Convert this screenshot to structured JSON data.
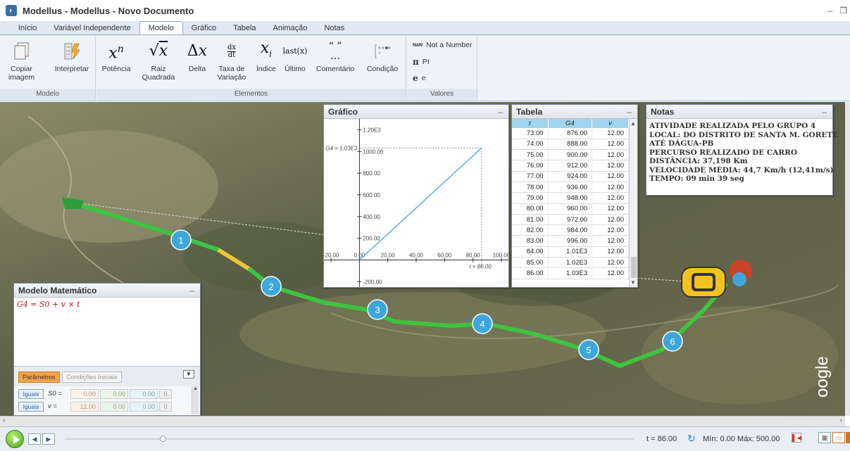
{
  "window": {
    "title": "Modellus - Modellus - Novo Documento"
  },
  "tabs": [
    {
      "label": "Início"
    },
    {
      "label": "Variável Independente"
    },
    {
      "label": "Modelo"
    },
    {
      "label": "Gráfico"
    },
    {
      "label": "Tabela"
    },
    {
      "label": "Animação"
    },
    {
      "label": "Notas"
    }
  ],
  "ribbon": {
    "modelo_group": {
      "label": "Modelo",
      "copy": "Copiar imagem",
      "interpret": "Interpretar"
    },
    "elementos_group": {
      "label": "Elementos",
      "potencia": "Potência",
      "raiz_1": "Raiz",
      "raiz_2": "Quadrada",
      "delta": "Delta",
      "taxa_1": "Taxa de",
      "taxa_2": "Variação",
      "indice": "Índice",
      "ultimo": "Último",
      "comentario": "Comentário",
      "condicao": "Condição",
      "last_symbol": "last(x)"
    },
    "valores_group": {
      "label": "Valores",
      "nan_tag": "NaN",
      "nan": "Not a Number",
      "pi_symbol": "π",
      "pi": "PI",
      "e_symbol": "e",
      "e": "e"
    }
  },
  "grafico": {
    "title": "Gráfico",
    "marker_left": "G4 = 1.03E3",
    "marker_bottom": "t = 86.00",
    "chart_data": {
      "type": "line",
      "x": [
        0,
        86
      ],
      "y": [
        0,
        1032
      ],
      "xlim": [
        -25,
        105
      ],
      "ylim": [
        -250,
        1300
      ],
      "xticks": [
        "-20.00",
        "0.00",
        "20.00",
        "40.00",
        "60.00",
        "80.00",
        "100.00"
      ],
      "yticks": [
        "-200.00",
        "200.00",
        "400.00",
        "600.00",
        "800.00",
        "1000.00",
        "1.20E3"
      ]
    }
  },
  "tabela": {
    "title": "Tabela",
    "columns": [
      "t",
      "G4",
      "v"
    ],
    "rows": [
      [
        "73.00",
        "876.00",
        "12.00"
      ],
      [
        "74.00",
        "888.00",
        "12.00"
      ],
      [
        "75.00",
        "900.00",
        "12.00"
      ],
      [
        "76.00",
        "912.00",
        "12.00"
      ],
      [
        "77.00",
        "924.00",
        "12.00"
      ],
      [
        "78.00",
        "936.00",
        "12.00"
      ],
      [
        "79.00",
        "948.00",
        "12.00"
      ],
      [
        "80.00",
        "960.00",
        "12.00"
      ],
      [
        "81.00",
        "972.00",
        "12.00"
      ],
      [
        "82.00",
        "984.00",
        "12.00"
      ],
      [
        "83.00",
        "996.00",
        "12.00"
      ],
      [
        "84.00",
        "1.01E3",
        "12.00"
      ],
      [
        "85.00",
        "1.02E3",
        "12.00"
      ],
      [
        "86.00",
        "1.03E3",
        "12.00"
      ]
    ]
  },
  "notas": {
    "title": "Notas",
    "lines": [
      "ATIVIDADE REALIZADA PELO GRUPO 4",
      "LOCAL: DO DISTRITO DE SANTA M. GORETE",
      "ATÉ DÁGUA-PB",
      "PERCURSO REALIZADO DE CARRO",
      "DISTÂNCIA: 37,198 Km",
      "VELOCIDADE MÉDIA: 44,7 Km/h (12,41m/s)",
      "TEMPO: 09 min 39 seg"
    ]
  },
  "modelo": {
    "title": "Modelo Matemático",
    "equation": "G4 = S0 + v × t",
    "tab_params": "Parâmetros",
    "tab_init": "Condições Iniciais",
    "rows": [
      {
        "btn": "Iguais",
        "label": "S0 =",
        "vals": [
          "0.00",
          "0.00",
          "0.00",
          "0."
        ]
      },
      {
        "btn": "Iguais",
        "label": "v =",
        "vals": [
          "12.00",
          "0.00",
          "0.00",
          "0."
        ]
      }
    ]
  },
  "map": {
    "markers": [
      "1",
      "2",
      "3",
      "4",
      "5",
      "6"
    ],
    "google_mark": "oogle"
  },
  "playback": {
    "t_readout": "t = 86.00",
    "min_max": "Mín: 0.00 Máx: 500.00",
    "progress": 0.172
  },
  "colors": {
    "route": "#3ec43e",
    "route_alt": "#f0c43a",
    "marker": "#3ea6db",
    "line": "#5aaee0",
    "accent": "#f5a34a"
  }
}
